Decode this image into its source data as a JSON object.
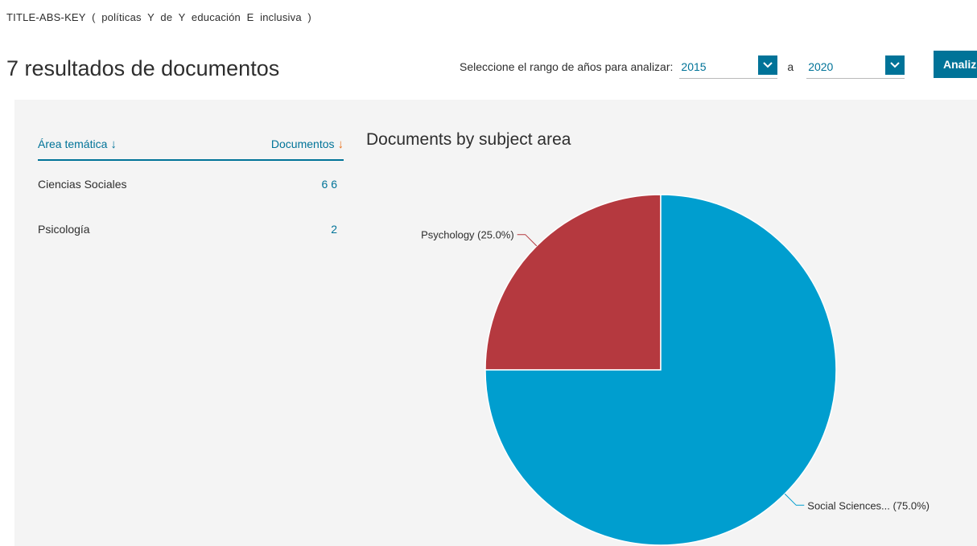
{
  "query": {
    "field": "TITLE-ABS-KEY",
    "open_paren": "(",
    "terms": [
      "políticas",
      "Y",
      "de",
      "Y",
      "educación",
      "E",
      "inclusiva"
    ],
    "close_paren": ")"
  },
  "header": {
    "results_title": "7 resultados de documentos",
    "range_label": "Seleccione el rango de años para analizar:",
    "from_year": "2015",
    "to_label": "a",
    "to_year": "2020",
    "analyze_label": "Analiz"
  },
  "table": {
    "col_area": "Área temática",
    "col_docs": "Documentos",
    "rows": [
      {
        "area": "Ciencias Sociales",
        "count": "6 6"
      },
      {
        "area": "Psicología",
        "count": "2"
      }
    ]
  },
  "chart_data": {
    "type": "pie",
    "title": "Documents by subject area",
    "slices": [
      {
        "label": "Psychology (25.0%)",
        "value": 25.0,
        "color": "#b5393f"
      },
      {
        "label": "Social Sciences... (75.0%)",
        "value": 75.0,
        "color": "#009ecf"
      }
    ]
  },
  "colors": {
    "accent": "#007398",
    "sort_arrow": "#e9711c",
    "panel_bg": "#f4f4f4"
  }
}
